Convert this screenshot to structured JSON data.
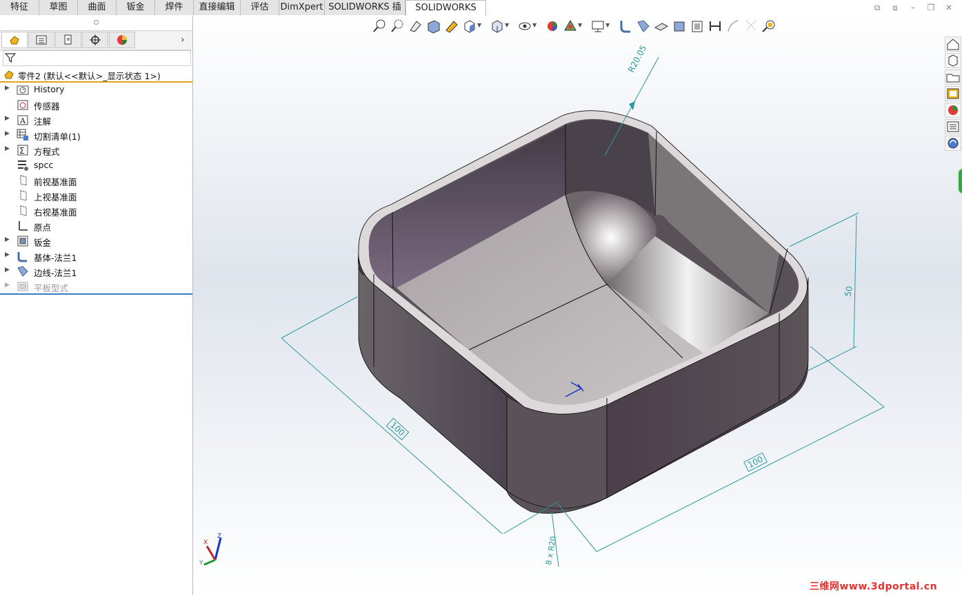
{
  "tabs": [
    {
      "label": "特征"
    },
    {
      "label": "草图"
    },
    {
      "label": "曲面"
    },
    {
      "label": "钣金"
    },
    {
      "label": "焊件"
    },
    {
      "label": "直接编辑"
    },
    {
      "label": "评估"
    },
    {
      "label": "DimXpert"
    },
    {
      "label": "SOLIDWORKS 插件"
    },
    {
      "label": "SOLIDWORKS MBD"
    }
  ],
  "active_tab": "SOLIDWORKS MBD",
  "part": {
    "label": "零件2 (默认<<默认>_显示状态 1>)"
  },
  "tree": [
    {
      "label": "History",
      "icon": "history-folder-icon",
      "expandable": true
    },
    {
      "label": "传感器",
      "icon": "sensor-icon",
      "expandable": false
    },
    {
      "label": "注解",
      "icon": "annotation-icon",
      "expandable": true
    },
    {
      "label": "切割清单(1)",
      "icon": "cutlist-icon",
      "expandable": true
    },
    {
      "label": "方程式",
      "icon": "equation-icon",
      "expandable": true
    },
    {
      "label": "spcc",
      "icon": "material-icon",
      "expandable": false
    },
    {
      "label": "前视基准面",
      "icon": "plane-icon",
      "expandable": false
    },
    {
      "label": "上视基准面",
      "icon": "plane-icon",
      "expandable": false
    },
    {
      "label": "右视基准面",
      "icon": "plane-icon",
      "expandable": false
    },
    {
      "label": "原点",
      "icon": "origin-icon",
      "expandable": false
    },
    {
      "label": "钣金",
      "icon": "sheetmetal-icon",
      "expandable": true
    },
    {
      "label": "基体-法兰1",
      "icon": "base-flange-icon",
      "expandable": true
    },
    {
      "label": "边线-法兰1",
      "icon": "edge-flange-icon",
      "expandable": true
    },
    {
      "label": "平板型式",
      "icon": "flat-pattern-icon",
      "expandable": true,
      "suppressed": true
    }
  ],
  "dimensions": {
    "radius_top": "R20.05",
    "height": "50",
    "width_left": "100",
    "width_right": "100",
    "bottom_radius": "8 x R20"
  },
  "triad": {
    "x": "X",
    "y": "Y",
    "z": "Z"
  },
  "watermark": "三维网www.3dportal.cn",
  "colors": {
    "model_outer": "#4a3f4c",
    "model_inner": "#8a8288",
    "dimension": "#2a9aa0",
    "tree_separator": "#e0a61a"
  }
}
